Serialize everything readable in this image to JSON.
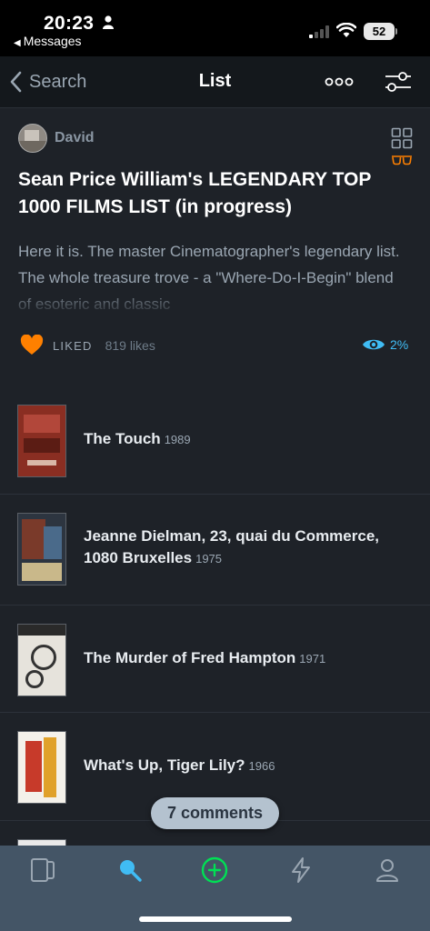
{
  "status_bar": {
    "time": "20:23",
    "back_app": "Messages",
    "battery": "52"
  },
  "nav": {
    "back_label": "Search",
    "title": "List"
  },
  "list": {
    "owner": "David",
    "title": "Sean Price William's LEGENDARY TOP 1000 FILMS LIST (in progress)",
    "description": "Here it is. The master Cinematographer's legendary list. The whole treasure trove - a \"Where-Do-I-Begin\" blend of esoteric and classic",
    "liked_label": "LIKED",
    "likes": "819 likes",
    "watched_percent": "2%"
  },
  "films": [
    {
      "title": "The Touch",
      "year": "1989"
    },
    {
      "title": "Jeanne Dielman, 23, quai du Commerce, 1080 Bruxelles",
      "year": "1975"
    },
    {
      "title": "The Murder of Fred Hampton",
      "year": "1971"
    },
    {
      "title": "What's Up, Tiger Lily?",
      "year": "1966"
    }
  ],
  "comments_button": "7 comments",
  "colors": {
    "background": "#1e2228",
    "accent_orange": "#ff8000",
    "accent_blue": "#40bcf4",
    "accent_green": "#00e054",
    "tab_bar": "#445566"
  },
  "icons": {
    "tabs": [
      "films-icon",
      "search-icon",
      "add-icon",
      "activity-icon",
      "profile-icon"
    ]
  }
}
